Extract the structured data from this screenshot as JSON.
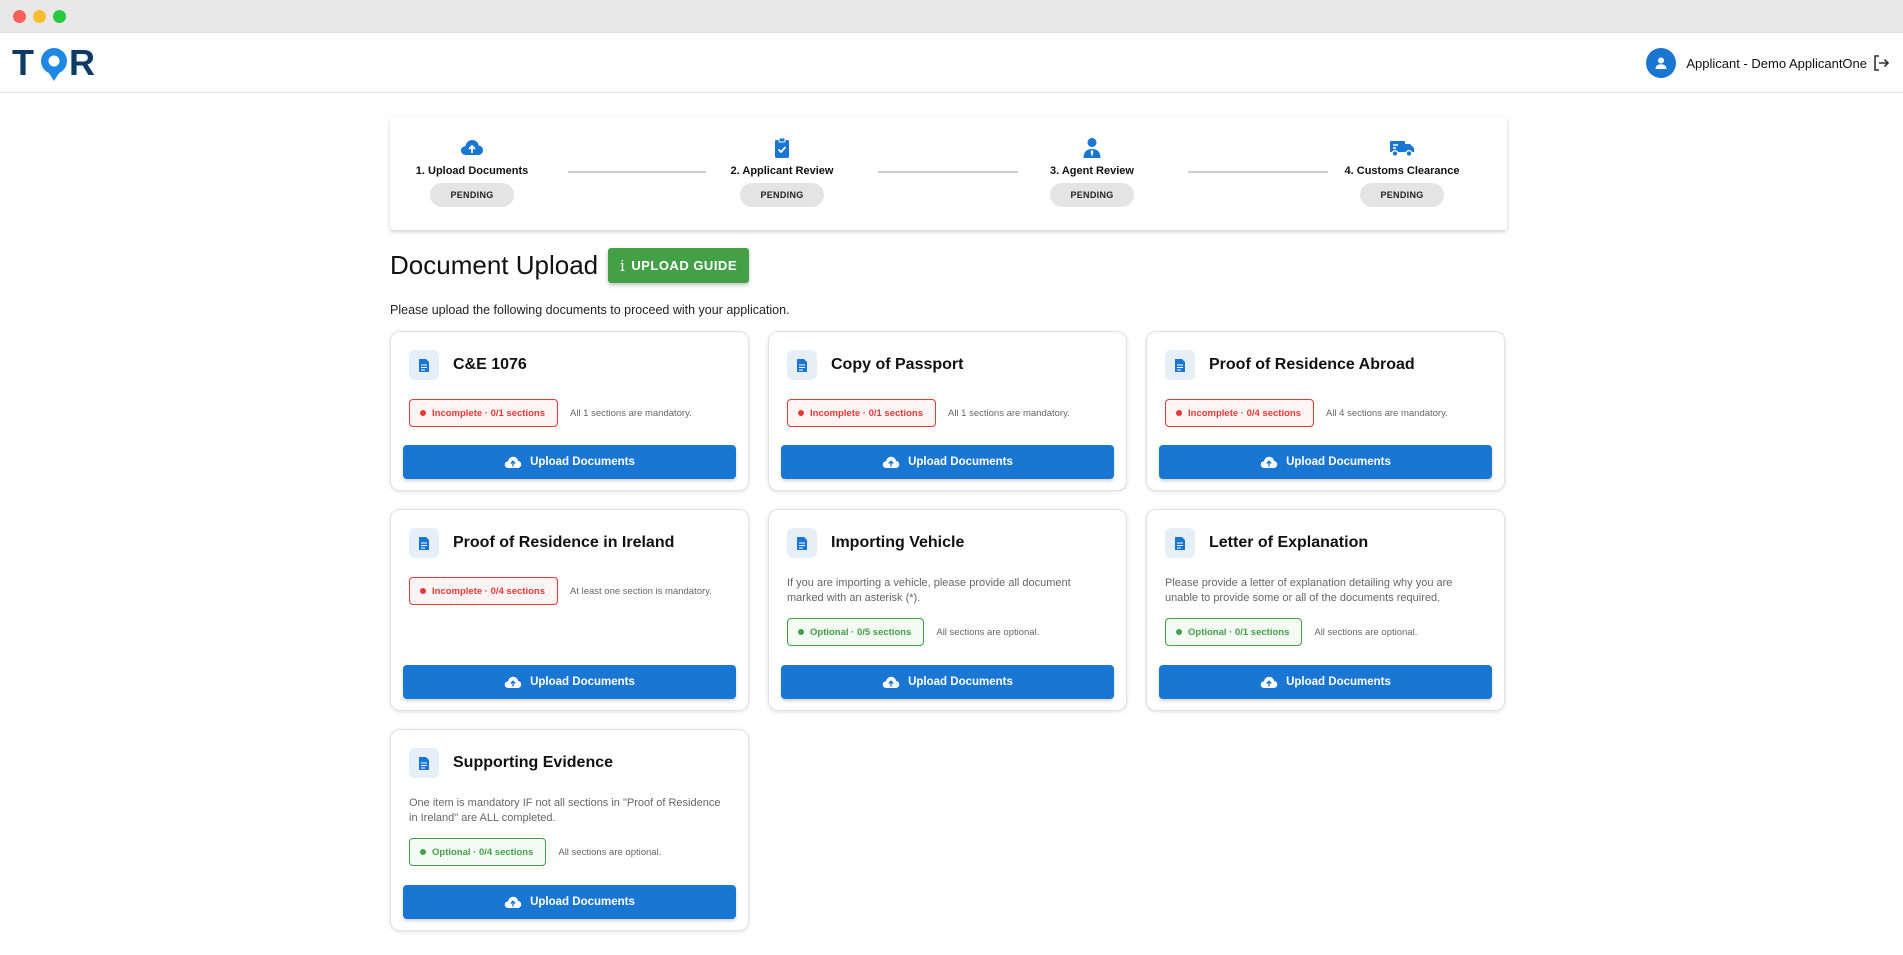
{
  "window": {
    "controls": [
      "close",
      "minimize",
      "zoom"
    ]
  },
  "header": {
    "logo_text": "TOR",
    "user_label": "Applicant - Demo ApplicantOne",
    "avatar_icon": "person-icon",
    "logout_icon": "logout-icon"
  },
  "stepper": {
    "steps": [
      {
        "label": "1. Upload Documents",
        "status": "PENDING",
        "icon": "cloud-upload-icon"
      },
      {
        "label": "2. Applicant Review",
        "status": "PENDING",
        "icon": "clipboard-check-icon"
      },
      {
        "label": "3. Agent Review",
        "status": "PENDING",
        "icon": "agent-icon"
      },
      {
        "label": "4. Customs Clearance",
        "status": "PENDING",
        "icon": "truck-icon"
      }
    ]
  },
  "main": {
    "title": "Document Upload",
    "guide_button": {
      "icon": "info-icon",
      "label": "UPLOAD GUIDE"
    },
    "intro": "Please upload the following documents to proceed with your application."
  },
  "cards": [
    {
      "title": "C&E 1076",
      "description": "",
      "status": "Incomplete · 0/1 sections",
      "status_kind": "incomplete",
      "note": "All 1 sections are mandatory.",
      "button": "Upload Documents"
    },
    {
      "title": "Copy of Passport",
      "description": "",
      "status": "Incomplete · 0/1 sections",
      "status_kind": "incomplete",
      "note": "All 1 sections are mandatory.",
      "button": "Upload Documents"
    },
    {
      "title": "Proof of Residence Abroad",
      "description": "",
      "status": "Incomplete · 0/4 sections",
      "status_kind": "incomplete",
      "note": "All 4 sections are mandatory.",
      "button": "Upload Documents"
    },
    {
      "title": "Proof of Residence in Ireland",
      "description": "",
      "status": "Incomplete · 0/4 sections",
      "status_kind": "incomplete",
      "note": "At least one section is mandatory.",
      "button": "Upload Documents"
    },
    {
      "title": "Importing Vehicle",
      "description": "If you are importing a vehicle, please provide all document marked with an asterisk (*).",
      "status": "Optional · 0/5 sections",
      "status_kind": "optional",
      "note": "All sections are optional.",
      "button": "Upload Documents"
    },
    {
      "title": "Letter of Explanation",
      "description": "Please provide a letter of explanation detailing why you are unable to provide some or all of the documents required.",
      "status": "Optional · 0/1 sections",
      "status_kind": "optional",
      "note": "All sections are optional.",
      "button": "Upload Documents"
    },
    {
      "title": "Supporting Evidence",
      "description": "One item is mandatory IF not all sections in \"Proof of Residence in Ireland\" are ALL completed.",
      "status": "Optional · 0/4 sections",
      "status_kind": "optional",
      "note": "All sections are optional.",
      "button": "Upload Documents"
    }
  ],
  "colors": {
    "primary": "#1976d2",
    "guide_green": "#43a047",
    "incomplete_red": "#e53935",
    "optional_green": "#43a047",
    "logo_navy": "#0d3b66"
  }
}
